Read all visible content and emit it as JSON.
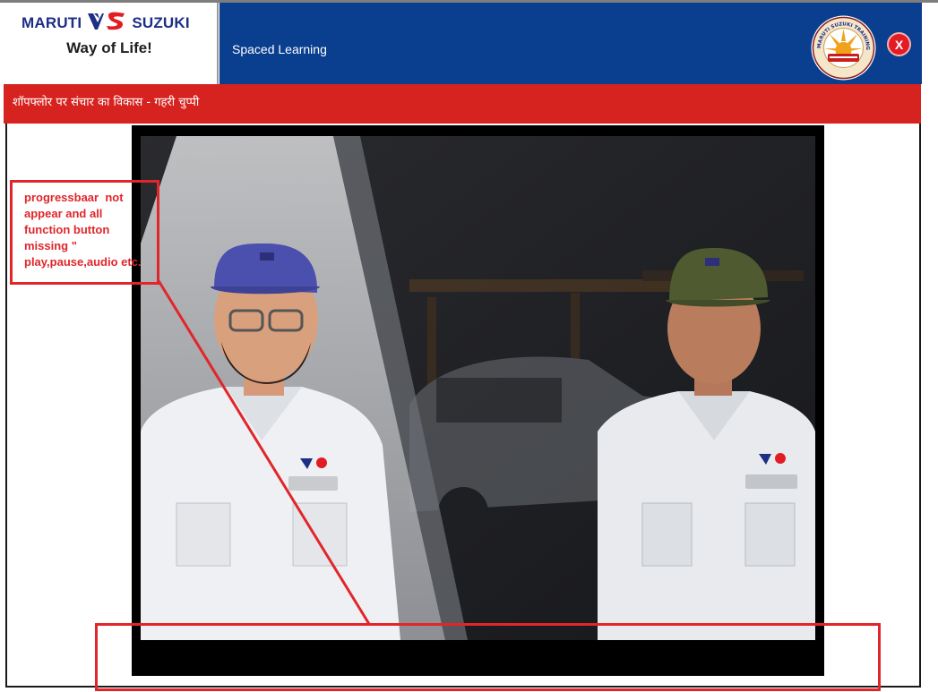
{
  "brand": {
    "left_word": "MARUTI",
    "right_word": "SUZUKI",
    "tagline": "Way of Life!",
    "logo_icon": "maruti-suzuki-logo-icon"
  },
  "header": {
    "title": "Spaced Learning",
    "academy_logo_icon": "training-academy-emblem-icon",
    "academy_logo_text": "MARUTI SUZUKI TRAINING ACADEMY",
    "close_label": "X"
  },
  "module": {
    "title": "शॉपफ्लोर पर संचार का विकास - गहरी चुप्पी"
  },
  "video": {
    "scene": "animated-two-technicians-scene"
  },
  "annotation": {
    "text": "progressbaar  not\nappear and all\nfunction button\nmissing \"\nplay,pause,audio etc."
  },
  "colors": {
    "header_blue": "#0a3e8f",
    "title_bar_red": "#d7231f",
    "annotation_red": "#e1262b"
  }
}
